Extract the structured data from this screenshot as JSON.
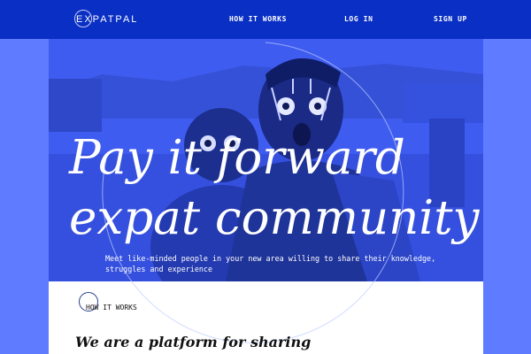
{
  "nav": {
    "logo": "EXPATPAL",
    "links": [
      {
        "label": "HOW IT WORKS"
      },
      {
        "label": "LOG IN"
      },
      {
        "label": "SIGN UP"
      }
    ]
  },
  "hero": {
    "title_lines": [
      "Pay it forward",
      "expat community"
    ],
    "subtitle": "Meet like-minded people in your new area willing to share their knowledge, struggles and experience"
  },
  "section": {
    "label": "HOW IT WORKS",
    "headline": "We are a platform for sharing"
  },
  "colors": {
    "nav_bg": "#0a2fc4",
    "page_bg": "#5f7bff",
    "hero_tint": "#3f5cf0",
    "text_light": "#ffffff",
    "text_dark": "#111111"
  }
}
